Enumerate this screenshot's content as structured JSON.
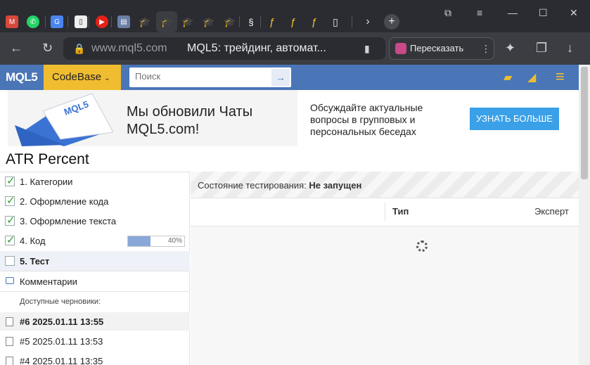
{
  "browser": {
    "url_host": "www.mql5.com",
    "tab_title": "MQL5: трейдинг, автомат...",
    "retell_label": "Пересказать"
  },
  "site": {
    "logo": "MQL5",
    "section": "CodeBase",
    "search_placeholder": "Поиск"
  },
  "banner": {
    "headline": "Мы обновили Чаты MQL5.com!",
    "text": "Обсуждайте актуальные вопросы в групповых и персональных беседах",
    "button": "УЗНАТЬ БОЛЬШЕ"
  },
  "page": {
    "title": "ATR Percent"
  },
  "steps": [
    {
      "label": "1. Категории",
      "checked": true
    },
    {
      "label": "2. Оформление кода",
      "checked": true
    },
    {
      "label": "3. Оформление текста",
      "checked": true
    },
    {
      "label": "4. Код",
      "checked": true,
      "progress": "40%",
      "progress_value": 0.4
    },
    {
      "label": "5. Тест",
      "checked": false
    }
  ],
  "comments_label": "Комментарии",
  "drafts": {
    "heading": "Доступные черновики:",
    "items": [
      "#6 2025.01.11 13:55",
      "#5 2025.01.11 13:53",
      "#4 2025.01.11 13:35"
    ]
  },
  "test": {
    "status_prefix": "Состояние тестирования:",
    "status_value": "Не запущен",
    "col_type": "Тип",
    "col_expert": "Эксперт"
  }
}
